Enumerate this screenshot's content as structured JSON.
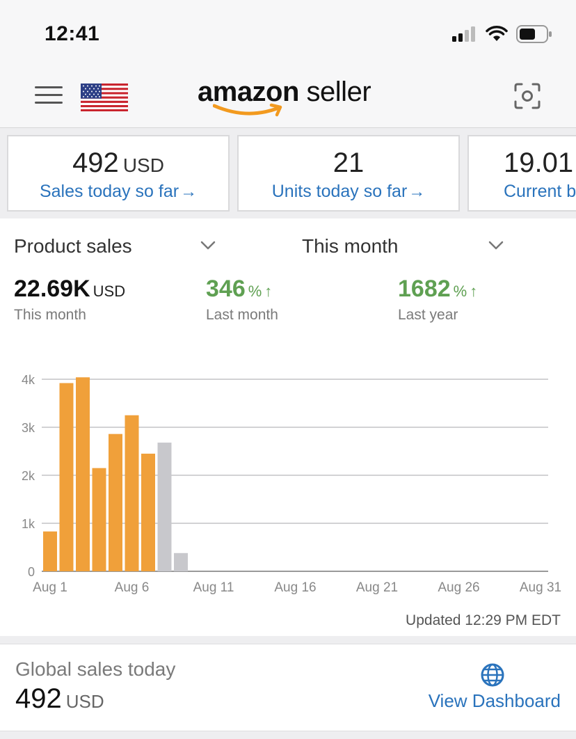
{
  "status_bar": {
    "time": "12:41"
  },
  "header": {
    "logo_bold": "amazon",
    "logo_light": " seller",
    "icons": {
      "menu": "hamburger-menu-icon",
      "flag": "us-flag-icon",
      "scan": "scan-icon"
    }
  },
  "kpis": [
    {
      "value": "492",
      "unit": "USD",
      "label": "Sales today so far",
      "arrow": "→"
    },
    {
      "value": "21",
      "unit": "",
      "label": "Units today so far",
      "arrow": "→"
    },
    {
      "value": "19.01",
      "unit": "",
      "label": "Current b",
      "arrow": ""
    }
  ],
  "sales": {
    "metric_select": "Product sales",
    "period_select": "This month",
    "this_month": {
      "value": "22.69K",
      "unit": "USD",
      "label": "This month"
    },
    "last_month": {
      "value": "346",
      "unit": "%",
      "arrow": "↑",
      "label": "Last month"
    },
    "last_year": {
      "value": "1682",
      "unit": "%",
      "arrow": "↑",
      "label": "Last year"
    },
    "updated": "Updated 12:29 PM EDT"
  },
  "chart_data": {
    "type": "bar",
    "x_tick_labels": [
      "Aug 1",
      "Aug 6",
      "Aug 11",
      "Aug 16",
      "Aug 21",
      "Aug 26",
      "Aug 31"
    ],
    "y_tick_labels": [
      "0",
      "1k",
      "2k",
      "3k",
      "4k"
    ],
    "ylim": [
      0,
      4000
    ],
    "grid": true,
    "colors": {
      "actual": "#f0a03a",
      "partial": "#c8c8cc"
    },
    "series": [
      {
        "days": [
          1,
          2,
          3,
          4,
          5,
          6,
          7
        ],
        "values": [
          830,
          3920,
          4040,
          2150,
          2860,
          3250,
          2450
        ]
      },
      {
        "days": [
          8,
          9
        ],
        "values": [
          2680,
          380
        ]
      }
    ]
  },
  "global": {
    "title": "Global sales today",
    "value": "492",
    "unit": "USD",
    "link": "View Dashboard",
    "icon": "globe-icon"
  }
}
